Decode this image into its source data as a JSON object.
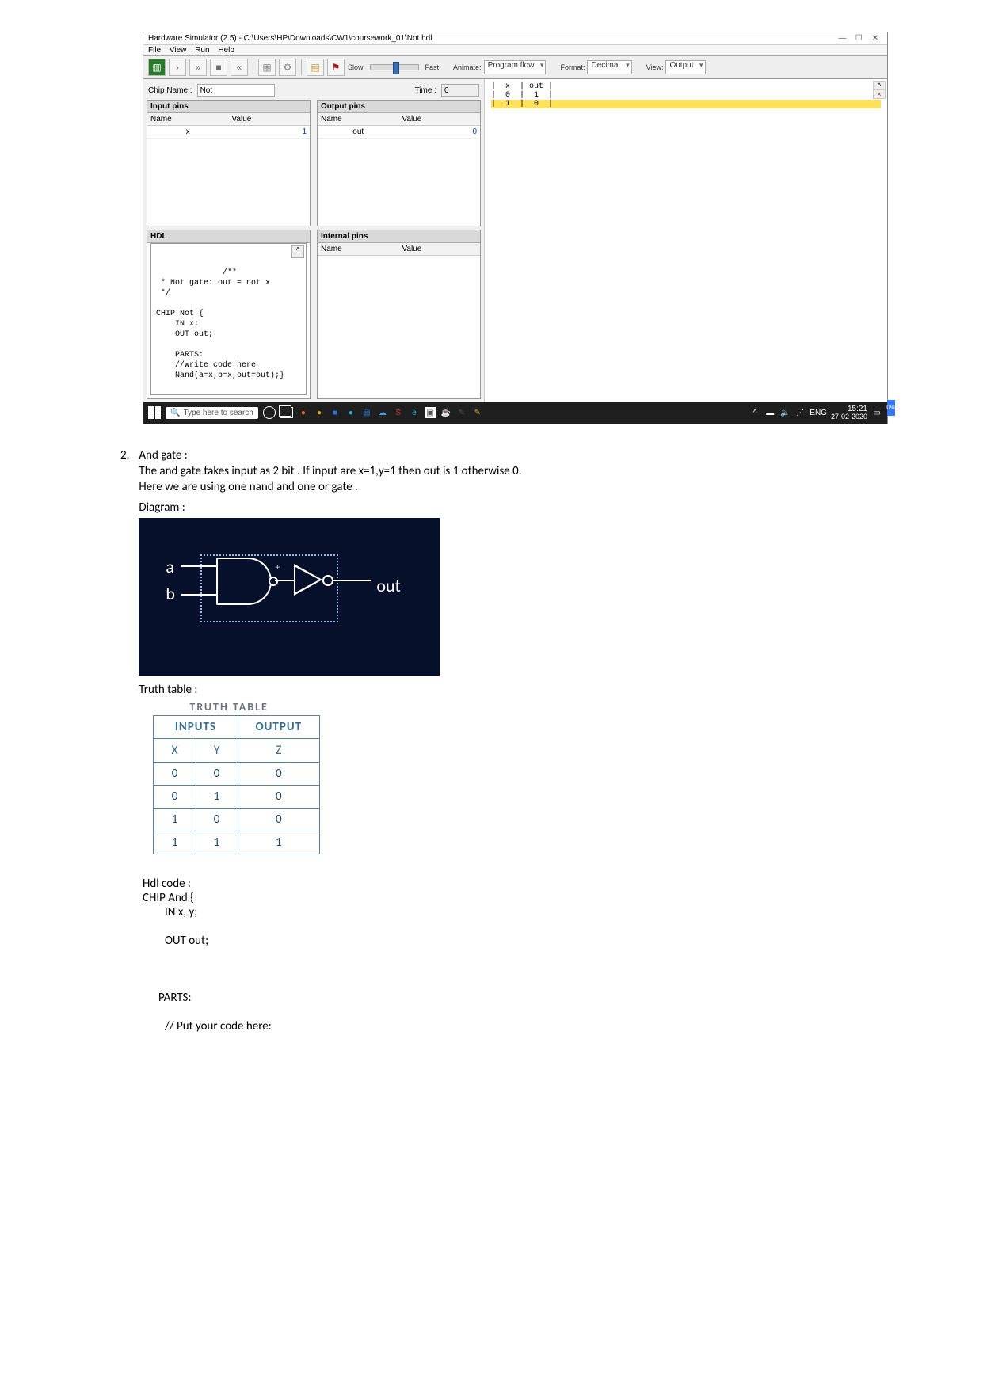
{
  "sim": {
    "title_prefix": "Hardware Simulator (2.5) - ",
    "title_path": "C:\\Users\\HP\\Downloads\\CW1\\coursework_01\\Not.hdl",
    "menus": [
      "File",
      "View",
      "Run",
      "Help"
    ],
    "slow": "Slow",
    "fast": "Fast",
    "animate_label": "Animate:",
    "animate_value": "Program flow",
    "format_label": "Format:",
    "format_value": "Decimal",
    "view_label": "View:",
    "view_value": "Output",
    "chip_label": "Chip Name :",
    "chip_value": "Not",
    "time_label": "Time :",
    "time_value": "0",
    "input_pins_hd": "Input pins",
    "output_pins_hd": "Output pins",
    "col_name": "Name",
    "col_value": "Value",
    "in_pin_name": "x",
    "in_pin_value": "1",
    "out_pin_name": "out",
    "out_pin_value": "0",
    "hdl_hd": "HDL",
    "internal_hd": "Internal pins",
    "hdl_code": "/**\n * Not gate: out = not x\n */\n\nCHIP Not {\n    IN x;\n    OUT out;\n\n    PARTS:\n    //Write code here\n    Nand(a=x,b=x,out=out);}",
    "out_row1": "|  x  | out |",
    "out_row2": "|  0  |  1  |",
    "out_row3": "|  1  |  0  |",
    "search": "Type here to search",
    "lang": "ENG",
    "time": "15:21",
    "date": "27-02-2020",
    "side_strip": "0%"
  },
  "doc": {
    "num": "2.",
    "title": "And gate :",
    "line1": "The and gate takes input as 2 bit . If input are x=1,y=1 then out is 1 otherwise 0.",
    "line2": "Here we are using one nand and one or gate .",
    "diagram_label": "Diagram :",
    "a": "a",
    "b": "b",
    "plus": "+",
    "out": "out",
    "truth_label": "Truth table :",
    "tt_title": "TRUTH TABLE",
    "tt_inputs": "INPUTS",
    "tt_output": "OUTPUT",
    "tt_cols": [
      "X",
      "Y",
      "Z"
    ],
    "tt_rows": [
      [
        "0",
        "0",
        "0"
      ],
      [
        "0",
        "1",
        "0"
      ],
      [
        "1",
        "0",
        "0"
      ],
      [
        "1",
        "1",
        "1"
      ]
    ],
    "hdl_label": "Hdl code :",
    "hdl_l1": "CHIP And {",
    "hdl_l2": "IN x, y;",
    "hdl_l3": "OUT out;",
    "hdl_l4": "PARTS:",
    "hdl_l5": "// Put your code here:"
  }
}
